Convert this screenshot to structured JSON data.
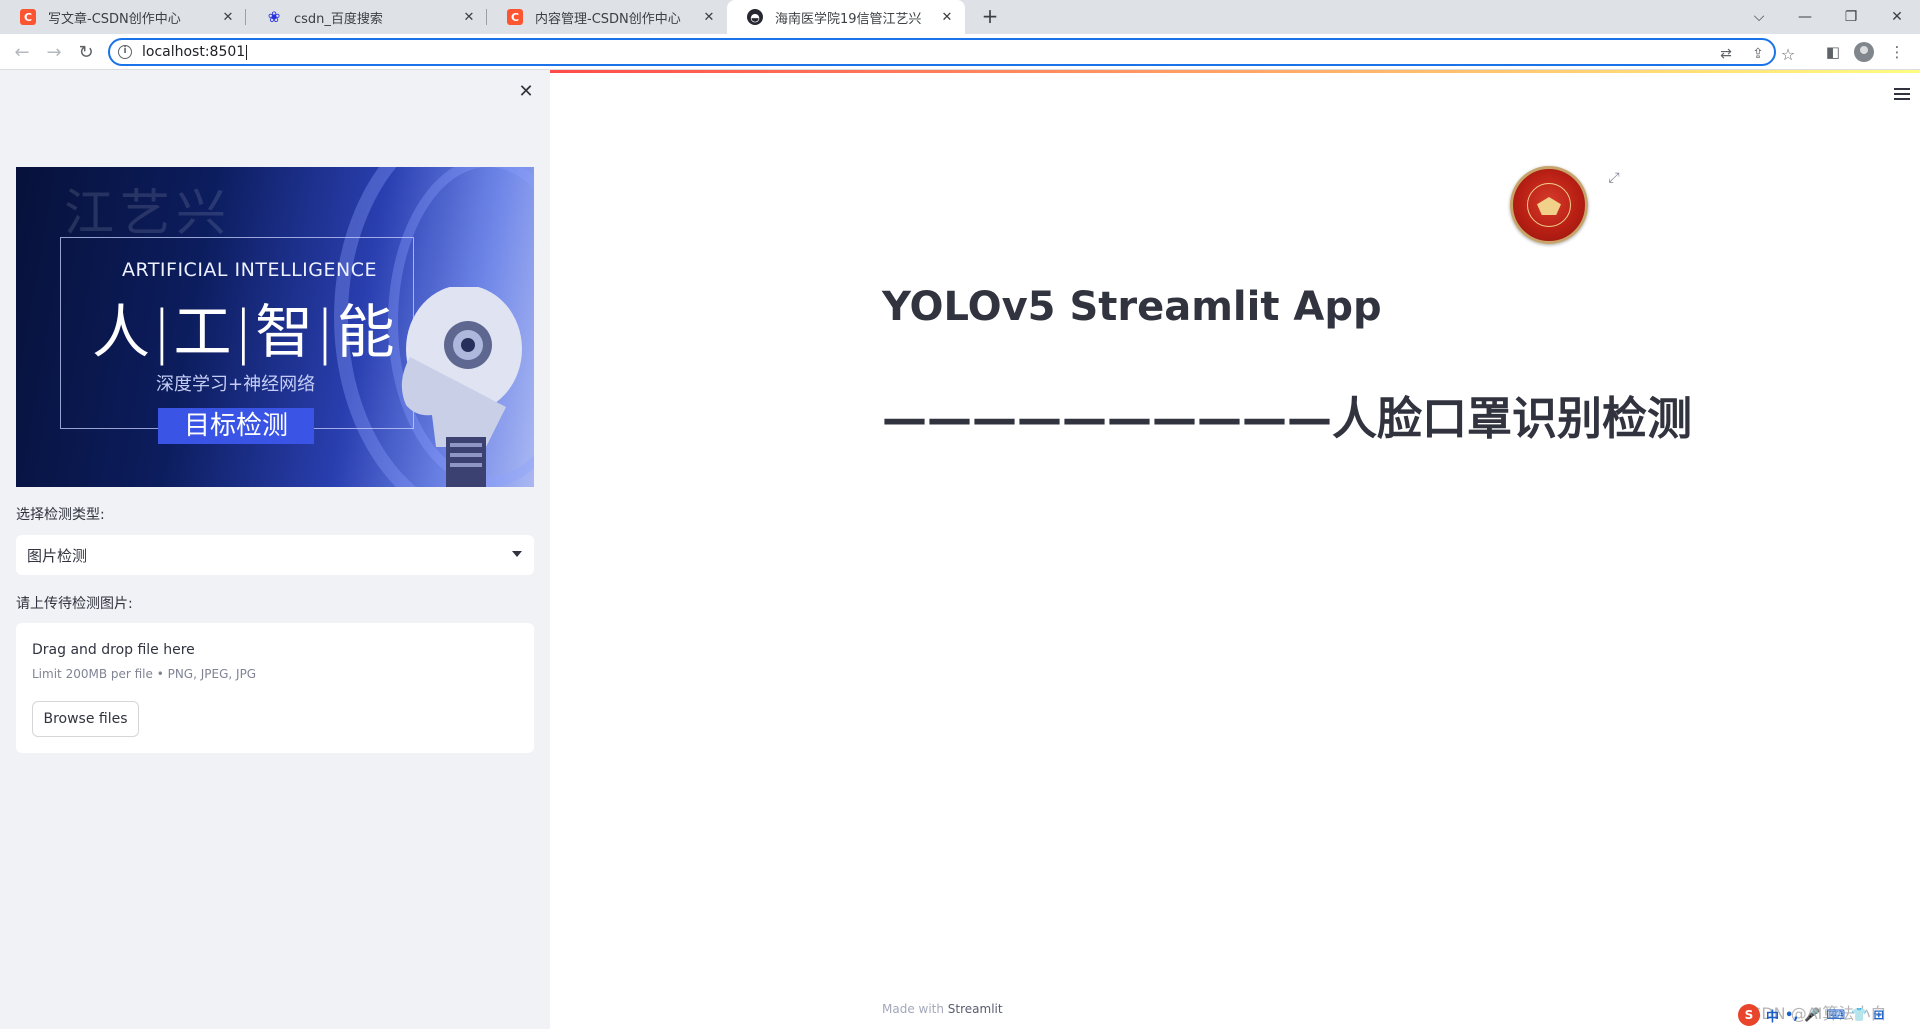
{
  "browser": {
    "tabs": [
      {
        "title": "写文章-CSDN创作中心",
        "icon": "csdn-icon",
        "icon_glyph": "C",
        "icon_color": "#fc5531",
        "active": false
      },
      {
        "title": "csdn_百度搜索",
        "icon": "baidu-paw-icon",
        "icon_glyph": "❀",
        "icon_color": "#2932e1",
        "active": false
      },
      {
        "title": "内容管理-CSDN创作中心",
        "icon": "csdn-icon",
        "icon_glyph": "C",
        "icon_color": "#fc5531",
        "active": false
      },
      {
        "title": "海南医学院19信管江艺兴",
        "icon": "streamlit-icon",
        "icon_glyph": "◓",
        "icon_color": "#262730",
        "active": true
      }
    ],
    "new_tab_glyph": "+",
    "url": "localhost:8501",
    "window_controls": {
      "tab_search": "⌵",
      "minimize": "—",
      "maximize": "❐",
      "close": "✕"
    }
  },
  "sidebar": {
    "close_glyph": "✕",
    "banner": {
      "watermark": "江艺兴",
      "english": "ARTIFICIAL INTELLIGENCE",
      "chinese": "人|工|智|能",
      "subtitle": "深度学习+神经网络",
      "tag": "目标检测"
    },
    "detect_type_label": "选择检测类型:",
    "detect_type_value": "图片检测",
    "upload_label": "请上传待检测图片:",
    "uploader": {
      "title": "Drag and drop file here",
      "limit": "Limit 200MB per file • PNG, JPEG, JPG",
      "browse": "Browse files"
    }
  },
  "main": {
    "title": "YOLOv5 Streamlit App",
    "subtitle": "——————————人脸口罩识别检测",
    "footer_prefix": "Made with ",
    "footer_brand": "Streamlit",
    "watermark": "CSDN @AI算法小白"
  },
  "tray": {
    "items": [
      "中",
      "•,",
      "🎤",
      "⌨",
      "👕",
      "⊞"
    ]
  },
  "colors": {
    "accent": "#1a73e8",
    "sidebar_bg": "#f0f2f6",
    "text": "#31333f",
    "decoration_start": "#ff4b4b",
    "decoration_end": "#fffd80"
  }
}
